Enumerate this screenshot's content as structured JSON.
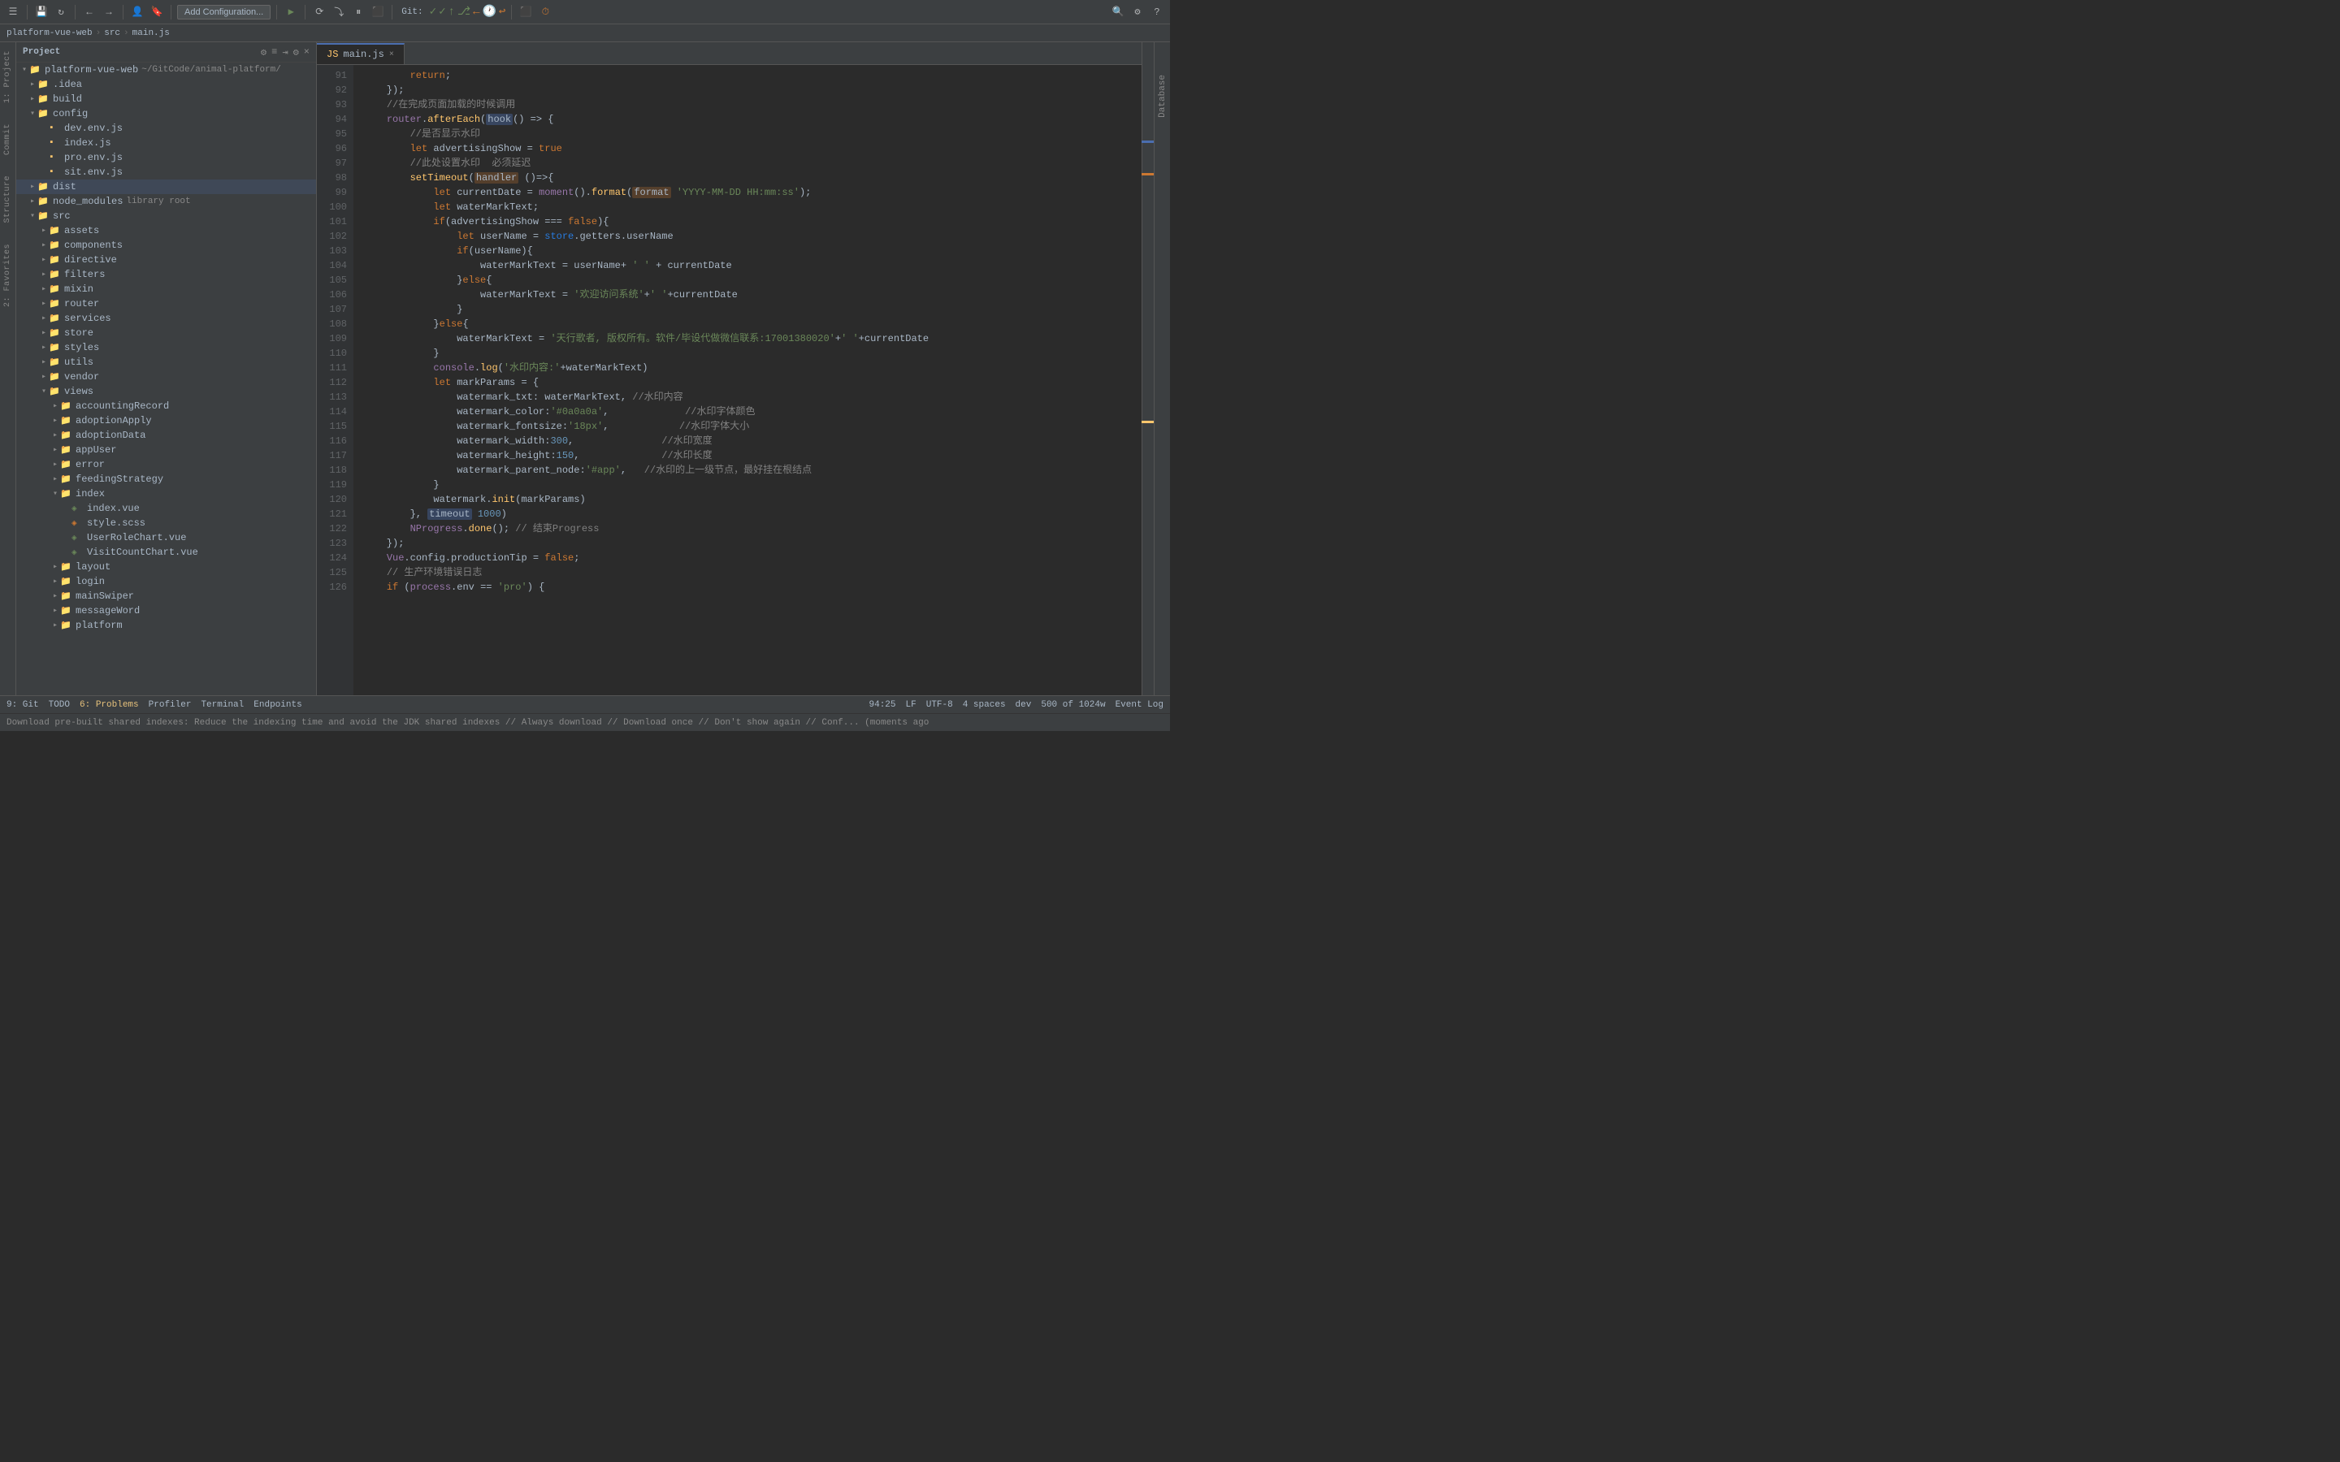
{
  "toolbar": {
    "add_config_label": "Add Configuration...",
    "git_label": "Git:",
    "run_icon": "▶",
    "stop_icon": "⬛"
  },
  "breadcrumb": {
    "project": "platform-vue-web",
    "sep1": ">",
    "src": "src",
    "sep2": ">",
    "file": "main.js"
  },
  "tabs": [
    {
      "label": "main.js",
      "active": true
    }
  ],
  "code_lines": [
    {
      "num": "91",
      "content_html": "        <span class='kw'>return</span>;"
    },
    {
      "num": "92",
      "content_html": "    });"
    },
    {
      "num": "93",
      "content_html": "    <span class='cmt'>//在完成页面加载的时候调用</span>"
    },
    {
      "num": "94",
      "content_html": "    <span class='purple'>router</span>.<span class='fn'>afterEach</span>(<span class='hl-box'>hook</span>() => {"
    },
    {
      "num": "95",
      "content_html": "        <span class='cmt'>//是否显示水印</span>"
    },
    {
      "num": "96",
      "content_html": "        <span class='kw'>let</span> advertisingShow = <span class='kw'>true</span>"
    },
    {
      "num": "97",
      "content_html": "        <span class='cmt'>//此处设置水印  必须延迟</span>"
    },
    {
      "num": "98",
      "content_html": "        <span class='fn'>setTimeout</span>(<span class='hl-orange'>handler</span> ()=>{"
    },
    {
      "num": "99",
      "content_html": "            <span class='kw'>let</span> currentDate = <span class='purple'>moment</span>().<span class='fn'>format</span>(<span class='hl-orange'>format</span> <span class='str'>'YYYY-MM-DD HH:mm:ss'</span>);"
    },
    {
      "num": "100",
      "content_html": "            <span class='kw'>let</span> waterMarkText;"
    },
    {
      "num": "101",
      "content_html": "            <span class='kw'>if</span>(advertisingShow === <span class='kw'>false</span>){"
    },
    {
      "num": "102",
      "content_html": "                <span class='kw'>let</span> userName = <span class='cyan'>store</span>.getters.userName"
    },
    {
      "num": "103",
      "content_html": "                <span class='kw'>if</span>(userName){"
    },
    {
      "num": "104",
      "content_html": "                    waterMarkText = userName+ <span class='str'>' '</span> + currentDate"
    },
    {
      "num": "105",
      "content_html": "                }<span class='kw'>else</span>{"
    },
    {
      "num": "106",
      "content_html": "                    waterMarkText = <span class='str'>'欢迎访问系统'</span>+<span class='str'>' '</span>+currentDate"
    },
    {
      "num": "107",
      "content_html": "                }"
    },
    {
      "num": "108",
      "content_html": "            }<span class='kw'>else</span>{"
    },
    {
      "num": "109",
      "content_html": "                waterMarkText = <span class='str'>'天行歌者, 版权所有。软件/毕设代做微信联系:17001380020'</span>+<span class='str'>' '</span>+currentDate"
    },
    {
      "num": "110",
      "content_html": "            }"
    },
    {
      "num": "111",
      "content_html": "            <span class='purple'>console</span>.<span class='fn'>log</span>(<span class='str'>'水印内容:'</span>+waterMarkText)"
    },
    {
      "num": "112",
      "content_html": "            <span class='kw'>let</span> markParams = {"
    },
    {
      "num": "113",
      "content_html": "                watermark_txt: waterMarkText, <span class='cmt'>//水印内容</span>"
    },
    {
      "num": "114",
      "content_html": "                watermark_color:<span class='str'>'#0a0a0a'</span>,             <span class='cmt'>//水印字体颜色</span>"
    },
    {
      "num": "115",
      "content_html": "                watermark_fontsize:<span class='str'>'18px'</span>,            <span class='cmt'>//水印字体大小</span>"
    },
    {
      "num": "116",
      "content_html": "                watermark_width:<span class='num'>300</span>,               <span class='cmt'>//水印宽度</span>"
    },
    {
      "num": "117",
      "content_html": "                watermark_height:<span class='num'>150</span>,              <span class='cmt'>//水印长度</span>"
    },
    {
      "num": "118",
      "content_html": "                watermark_parent_node:<span class='str'>'#app'</span>,   <span class='cmt'>//水印的上一级节点，最好挂在根结点</span>"
    },
    {
      "num": "119",
      "content_html": "            }"
    },
    {
      "num": "120",
      "content_html": "            watermark.<span class='fn'>init</span>(markParams)"
    },
    {
      "num": "121",
      "content_html": "        }, <span class='hl-box'>timeout</span> <span class='num'>1000</span>)"
    },
    {
      "num": "122",
      "content_html": "        <span class='purple'>NProgress</span>.<span class='fn'>done</span>(); <span class='cmt'>// 结束Progress</span>"
    },
    {
      "num": "123",
      "content_html": "    });"
    },
    {
      "num": "124",
      "content_html": "    <span class='purple'>Vue</span>.config.productionTip = <span class='kw'>false</span>;"
    },
    {
      "num": "125",
      "content_html": "    <span class='cmt'>// 生产环境错误日志</span>"
    },
    {
      "num": "126",
      "content_html": "    <span class='kw'>if</span> (<span class='purple'>process</span>.env <span class='op'>==</span> <span class='str'>'pro'</span>) {"
    }
  ],
  "tree": {
    "root_label": "platform-vue-web",
    "root_path": "~/GitCode/animal-platform/",
    "items": [
      {
        "indent": 1,
        "arrow": "closed",
        "type": "folder",
        "label": ".idea"
      },
      {
        "indent": 1,
        "arrow": "closed",
        "type": "folder",
        "label": "build"
      },
      {
        "indent": 1,
        "arrow": "open",
        "type": "folder",
        "label": "config"
      },
      {
        "indent": 2,
        "arrow": "none",
        "type": "js",
        "label": "dev.env.js"
      },
      {
        "indent": 2,
        "arrow": "none",
        "type": "js",
        "label": "index.js"
      },
      {
        "indent": 2,
        "arrow": "none",
        "type": "js",
        "label": "pro.env.js"
      },
      {
        "indent": 2,
        "arrow": "none",
        "type": "js",
        "label": "sit.env.js"
      },
      {
        "indent": 1,
        "arrow": "closed",
        "type": "folder",
        "label": "dist",
        "highlighted": true
      },
      {
        "indent": 1,
        "arrow": "closed",
        "type": "folder",
        "label": "node_modules",
        "sublabel": "library root"
      },
      {
        "indent": 1,
        "arrow": "open",
        "type": "folder",
        "label": "src"
      },
      {
        "indent": 2,
        "arrow": "closed",
        "type": "folder",
        "label": "assets"
      },
      {
        "indent": 2,
        "arrow": "closed",
        "type": "folder",
        "label": "components"
      },
      {
        "indent": 2,
        "arrow": "closed",
        "type": "folder",
        "label": "directive"
      },
      {
        "indent": 2,
        "arrow": "closed",
        "type": "folder",
        "label": "filters"
      },
      {
        "indent": 2,
        "arrow": "closed",
        "type": "folder",
        "label": "mixin"
      },
      {
        "indent": 2,
        "arrow": "closed",
        "type": "folder",
        "label": "router"
      },
      {
        "indent": 2,
        "arrow": "closed",
        "type": "folder",
        "label": "services"
      },
      {
        "indent": 2,
        "arrow": "closed",
        "type": "folder",
        "label": "store"
      },
      {
        "indent": 2,
        "arrow": "closed",
        "type": "folder",
        "label": "styles"
      },
      {
        "indent": 2,
        "arrow": "closed",
        "type": "folder",
        "label": "utils"
      },
      {
        "indent": 2,
        "arrow": "closed",
        "type": "folder",
        "label": "vendor"
      },
      {
        "indent": 2,
        "arrow": "open",
        "type": "folder",
        "label": "views"
      },
      {
        "indent": 3,
        "arrow": "closed",
        "type": "folder",
        "label": "accountingRecord"
      },
      {
        "indent": 3,
        "arrow": "closed",
        "type": "folder",
        "label": "adoptionApply"
      },
      {
        "indent": 3,
        "arrow": "closed",
        "type": "folder",
        "label": "adoptionData"
      },
      {
        "indent": 3,
        "arrow": "closed",
        "type": "folder",
        "label": "appUser"
      },
      {
        "indent": 3,
        "arrow": "closed",
        "type": "folder",
        "label": "error"
      },
      {
        "indent": 3,
        "arrow": "closed",
        "type": "folder",
        "label": "feedingStrategy"
      },
      {
        "indent": 3,
        "arrow": "open",
        "type": "folder",
        "label": "index"
      },
      {
        "indent": 4,
        "arrow": "none",
        "type": "vue",
        "label": "index.vue"
      },
      {
        "indent": 4,
        "arrow": "none",
        "type": "scss",
        "label": "style.scss"
      },
      {
        "indent": 4,
        "arrow": "none",
        "type": "vue",
        "label": "UserRoleChart.vue"
      },
      {
        "indent": 4,
        "arrow": "none",
        "type": "vue",
        "label": "VisitCountChart.vue"
      },
      {
        "indent": 3,
        "arrow": "closed",
        "type": "folder",
        "label": "layout"
      },
      {
        "indent": 3,
        "arrow": "closed",
        "type": "folder",
        "label": "login"
      },
      {
        "indent": 3,
        "arrow": "closed",
        "type": "folder",
        "label": "mainSwiper"
      },
      {
        "indent": 3,
        "arrow": "closed",
        "type": "folder",
        "label": "messageWord"
      },
      {
        "indent": 3,
        "arrow": "closed",
        "type": "folder",
        "label": "platform"
      }
    ]
  },
  "statusbar": {
    "git": "9: Git",
    "todo": "TODO",
    "problems": "6: Problems",
    "profiler": "Profiler",
    "terminal": "Terminal",
    "endpoints": "Endpoints",
    "line_col": "94:25",
    "lf": "LF",
    "encoding": "UTF-8",
    "indent": "4 spaces",
    "branch": "dev",
    "position": "500 of 1024w",
    "event_log": "Event Log"
  },
  "notification": {
    "text": "Download pre-built shared indexes: Reduce the indexing time and avoid the JDK shared indexes // Always download // Download once // Don't show again // Conf... (moments ago"
  },
  "far_right_tabs": [
    "Database"
  ],
  "far_left_sections": [
    "1: Project",
    "Commit",
    "Structure",
    "2: Favorites"
  ]
}
